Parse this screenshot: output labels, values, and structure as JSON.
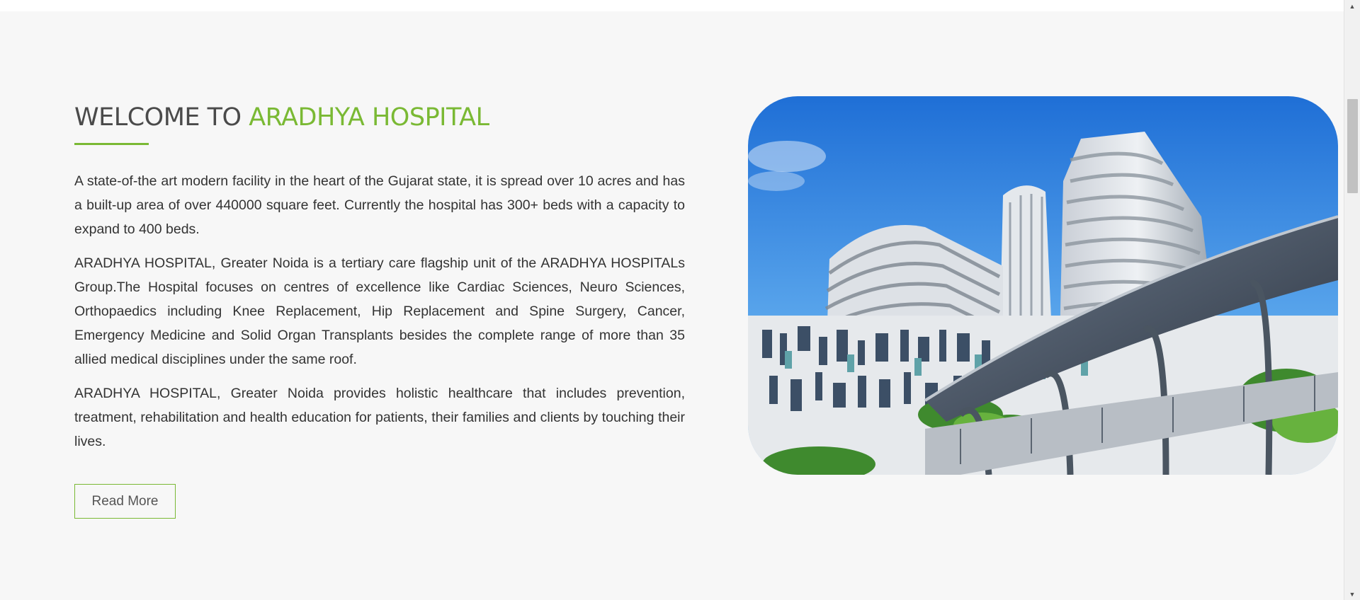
{
  "welcome": {
    "heading_prefix": "WELCOME TO ",
    "heading_accent": "ARADHYA HOSPITAL",
    "paragraphs": [
      "A state-of-the art modern facility in the heart of the Gujarat state, it is spread over 10 acres and has a built-up area of over 440000 square feet. Currently the hospital has 300+ beds with a capacity to expand to 400 beds.",
      "ARADHYA HOSPITAL, Greater Noida is a tertiary care flagship unit of the ARADHYA HOSPITALs Group.The Hospital focuses on centres of excellence like Cardiac Sciences, Neuro Sciences, Orthopaedics including Knee Replacement, Hip Replacement and Spine Surgery, Cancer, Emergency Medicine and Solid Organ Transplants besides the complete range of more than 35 allied medical disciplines under the same roof.",
      "ARADHYA HOSPITAL, Greater Noida provides holistic healthcare that includes prevention, treatment, rehabilitation and health education for patients, their families and clients by touching their lives."
    ],
    "read_more_label": "Read More"
  },
  "colors": {
    "accent": "#7ab934",
    "heading": "#4a4a4a",
    "body_text": "#333333",
    "background": "#f7f7f7"
  },
  "icons": {
    "scroll_up": "triangle-up-icon",
    "scroll_down": "triangle-down-icon"
  },
  "scrollbar": {
    "position_fraction": 0.12
  }
}
